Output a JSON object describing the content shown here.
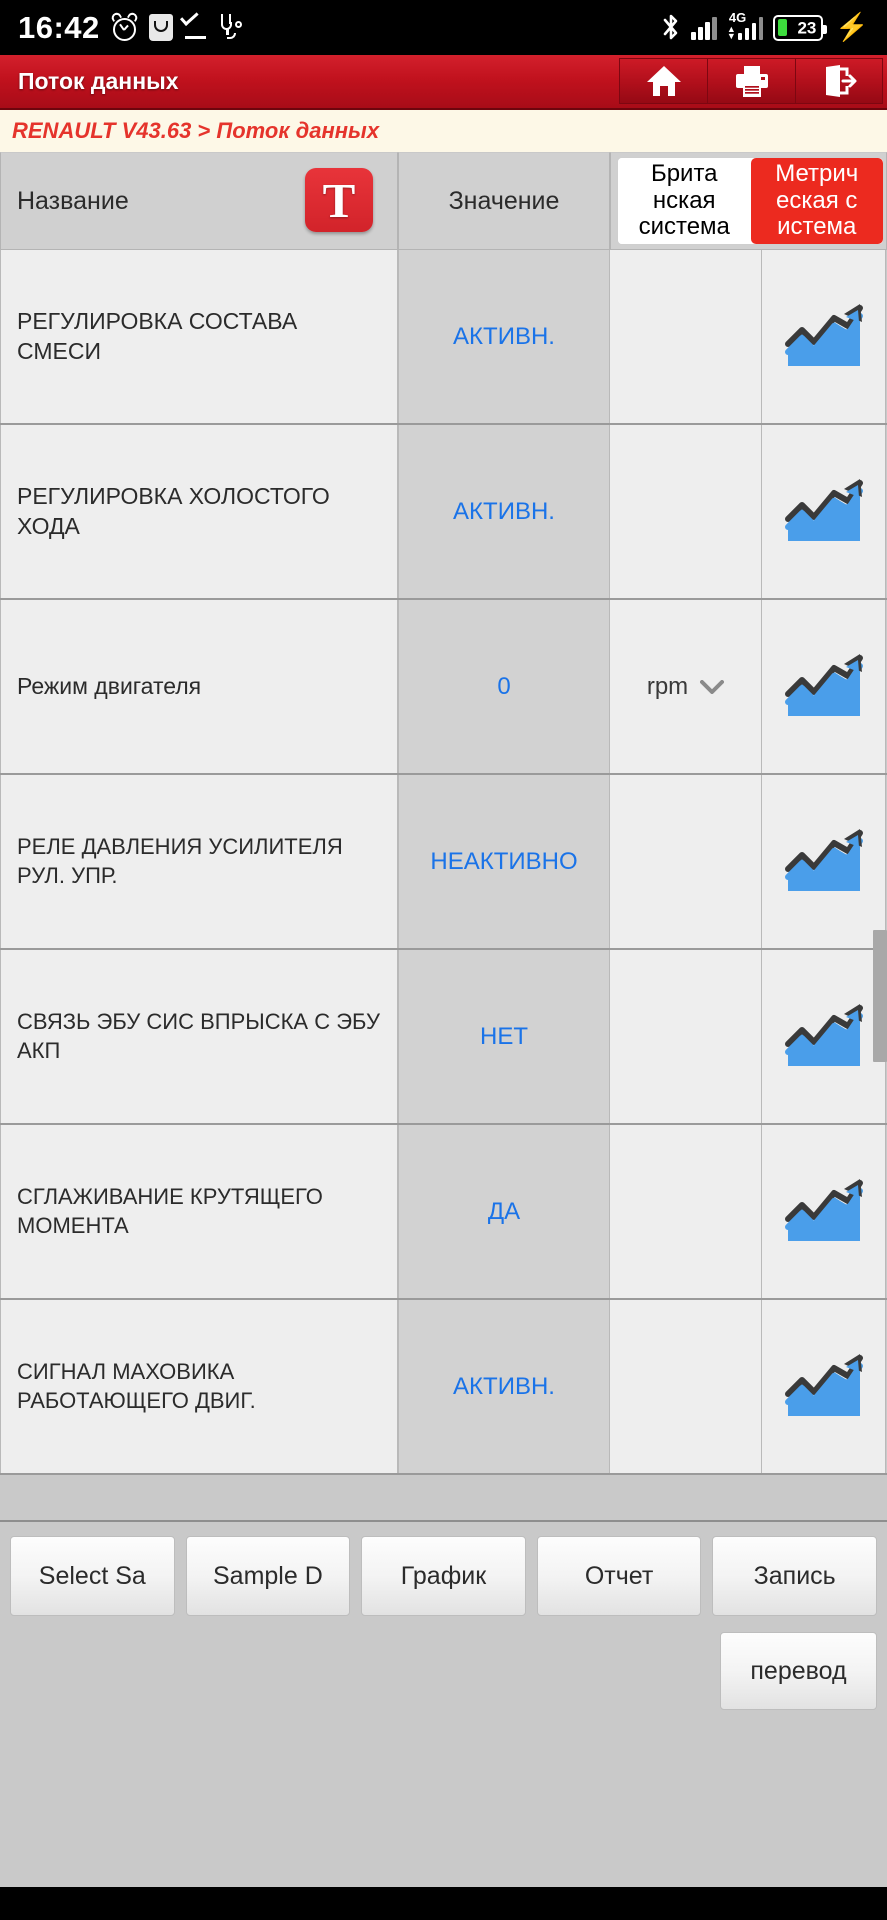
{
  "status_bar": {
    "time": "16:42",
    "battery_percent": "23",
    "network_label": "4G",
    "icons": [
      "alarm-clock-icon",
      "app-notification-icon",
      "download-complete-icon",
      "stethoscope-icon",
      "bluetooth-icon",
      "signal-bars-icon",
      "4g-signal-icon",
      "battery-icon",
      "charging-bolt-icon"
    ]
  },
  "title_bar": {
    "title": "Поток данных",
    "buttons": [
      {
        "name": "home-button",
        "icon": "home-icon"
      },
      {
        "name": "print-button",
        "icon": "printer-icon"
      },
      {
        "name": "exit-button",
        "icon": "exit-door-icon"
      }
    ]
  },
  "breadcrumb": {
    "text": "RENAULT V43.63 > Поток данных"
  },
  "table_header": {
    "name_label": "Название",
    "translate_icon_letter": "T",
    "value_label": "Значение",
    "unit_toggle": {
      "imperial": {
        "lines": [
          "Брита",
          "нская",
          "система"
        ],
        "selected": false
      },
      "metric": {
        "lines": [
          "Метрич",
          "еская с",
          "истема"
        ],
        "selected": true
      }
    }
  },
  "rows": [
    {
      "name": "РЕГУЛИРОВКА СОСТАВА СМЕСИ",
      "value": "АКТИВН.",
      "unit": "",
      "has_dropdown": false
    },
    {
      "name": "РЕГУЛИРОВКА ХОЛОСТОГО ХОДА",
      "value": "АКТИВН.",
      "unit": "",
      "has_dropdown": false
    },
    {
      "name": "Режим двигателя",
      "value": "0",
      "unit": "rpm",
      "has_dropdown": true
    },
    {
      "name": "РЕЛЕ ДАВЛЕНИЯ УСИЛИТЕЛЯ РУЛ. УПР.",
      "value": "НЕАКТИВНО",
      "unit": "",
      "has_dropdown": false
    },
    {
      "name": "СВЯЗЬ ЭБУ СИС ВПРЫСКА С ЭБУ АКП",
      "value": "НЕТ",
      "unit": "",
      "has_dropdown": false
    },
    {
      "name": "СГЛАЖИВАНИЕ КРУТЯЩЕГО МОМЕНТА",
      "value": "ДА",
      "unit": "",
      "has_dropdown": false
    },
    {
      "name": "СИГНАЛ МАХОВИКА РАБОТАЮЩЕГО ДВИГ.",
      "value": "АКТИВН.",
      "unit": "",
      "has_dropdown": false
    }
  ],
  "bottom_bar": {
    "buttons": [
      "Select Sa",
      "Sample D",
      "График",
      "Отчет",
      "Запись"
    ],
    "translate_button": "перевод"
  },
  "colors": {
    "brand_red": "#c0111d",
    "accent_red": "#ec2a1f",
    "value_blue": "#1a73e8",
    "breadcrumb_bg": "#fdf8e7",
    "battery_green": "#3ddc3d"
  }
}
